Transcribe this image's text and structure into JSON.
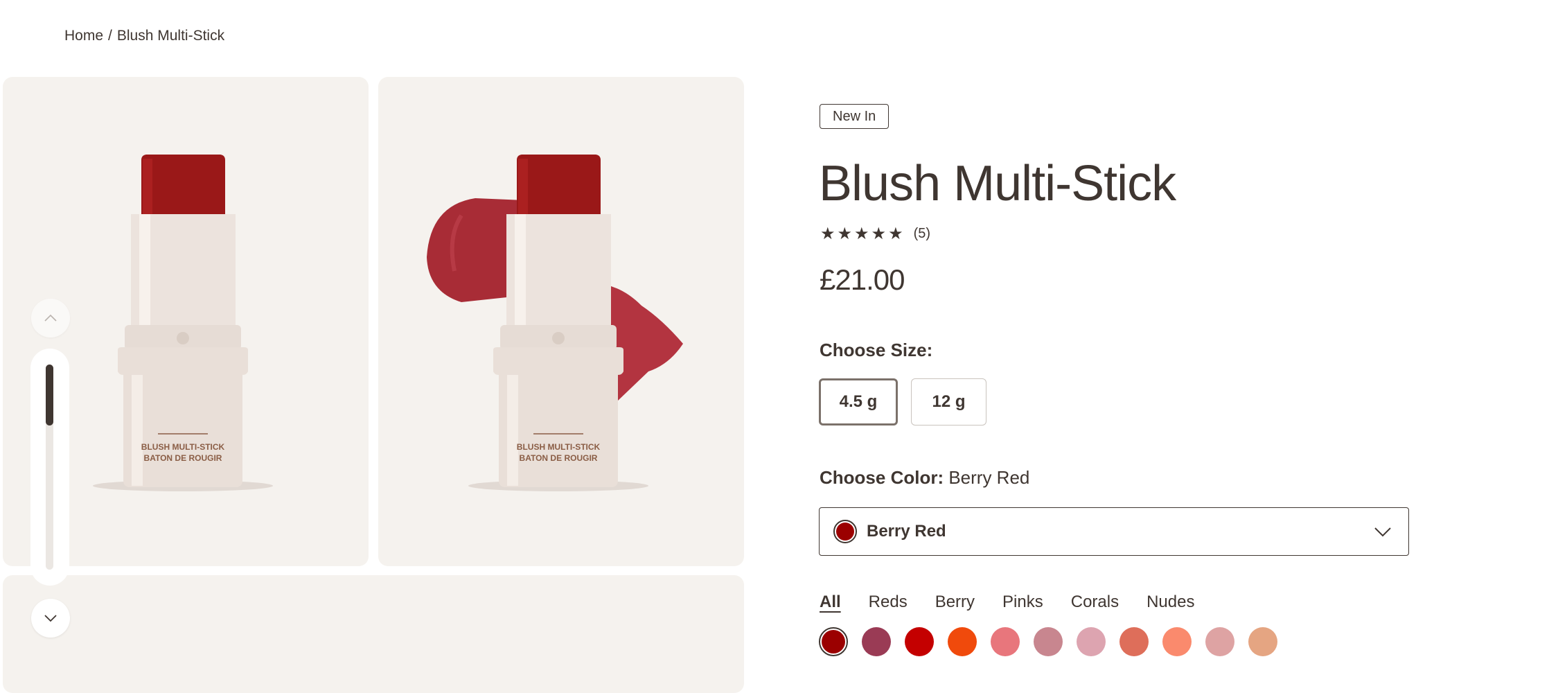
{
  "breadcrumb": {
    "home": "Home",
    "separator": "/",
    "current": "Blush Multi-Stick"
  },
  "gallery": {
    "tube_text_line1": "BLUSH MULTI-STICK",
    "tube_text_line2": "BATON DE ROUGIR",
    "scroll_position": 0.2
  },
  "product": {
    "badge": "New In",
    "title": "Blush Multi-Stick",
    "stars": "★★★★★",
    "rating_count": "(5)",
    "price": "£21.00"
  },
  "size": {
    "label": "Choose Size:",
    "options": [
      "4.5 g",
      "12 g"
    ],
    "selected": 0
  },
  "color": {
    "label": "Choose Color:",
    "selected_name": "Berry Red",
    "selected_hex": "#9b0000",
    "filters": [
      "All",
      "Reds",
      "Berry",
      "Pinks",
      "Corals",
      "Nudes"
    ],
    "active_filter": "All",
    "swatches": [
      "#9b0000",
      "#9a3b55",
      "#c40000",
      "#f04a0c",
      "#e8767c",
      "#c8868f",
      "#dda4b0",
      "#de6e5a",
      "#fa8a6d",
      "#dea3a3",
      "#e5a582"
    ]
  },
  "colors": {
    "text": "#3f3631",
    "panel": "#f5f2ee",
    "cap": "#9a1818",
    "tube": "#e8ded8"
  },
  "icons": {
    "up": "chevron-up-icon",
    "down": "chevron-down-icon",
    "select": "chevron-down-icon"
  }
}
